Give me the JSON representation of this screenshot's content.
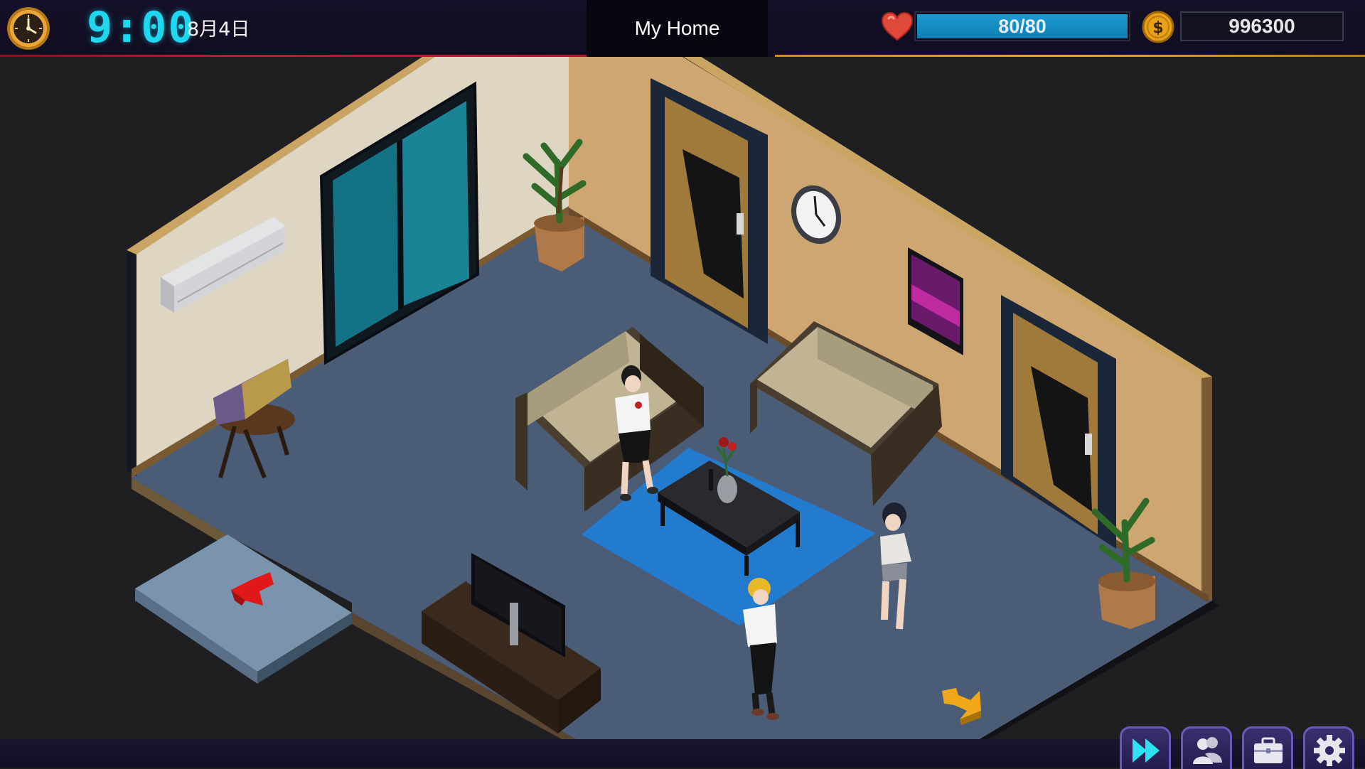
{
  "hud": {
    "time": "9:00",
    "date": "8月4日",
    "location": "My Home",
    "health": {
      "text": "80/80",
      "current": 80,
      "max": 80,
      "color": "#1a9bd0"
    },
    "money": "996300"
  },
  "scene": {
    "exits": [
      {
        "name": "exit-arrow-left",
        "icon": "red-arrow",
        "color": "#e01818"
      },
      {
        "name": "exit-arrow-right",
        "icon": "yellow-arrow",
        "color": "#f0a818"
      }
    ]
  },
  "bottom_bar": {
    "buttons": [
      {
        "name": "fast-forward-button",
        "icon": "fast-forward-icon"
      },
      {
        "name": "contacts-button",
        "icon": "people-icon"
      },
      {
        "name": "inventory-button",
        "icon": "briefcase-icon"
      },
      {
        "name": "settings-button",
        "icon": "gear-icon"
      }
    ]
  }
}
